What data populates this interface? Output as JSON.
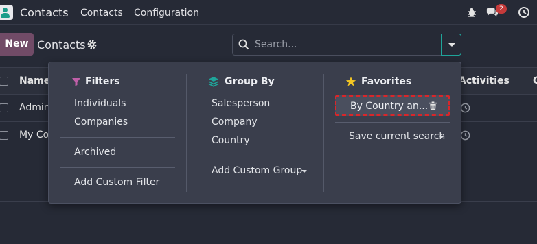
{
  "navbar": {
    "app_name": "Contacts",
    "menu": [
      "Contacts",
      "Configuration"
    ],
    "messages_count": "2",
    "icons": [
      "contacts-app-icon",
      "bug-icon",
      "chat-icon",
      "clock-icon"
    ]
  },
  "control_panel": {
    "new_label": "New",
    "title": "Contacts",
    "search_placeholder": "Search..."
  },
  "table": {
    "columns": [
      "Name",
      "Activities",
      "C"
    ],
    "rows": [
      {
        "name": "Admin"
      },
      {
        "name": "My Co"
      }
    ]
  },
  "dropdown": {
    "filters": {
      "title": "Filters",
      "items": [
        "Individuals",
        "Companies",
        "Archived",
        "Add Custom Filter"
      ]
    },
    "group_by": {
      "title": "Group By",
      "items": [
        "Salesperson",
        "Company",
        "Country",
        "Add Custom Group"
      ]
    },
    "favorites": {
      "title": "Favorites",
      "items": [
        "By Country an...",
        "Save current search"
      ]
    }
  },
  "colors": {
    "background": "#262a36",
    "primary": "#714b67",
    "accent": "#1fa59a",
    "dropdown_bg": "#3a3e4c",
    "highlight_border": "#d9262a"
  }
}
